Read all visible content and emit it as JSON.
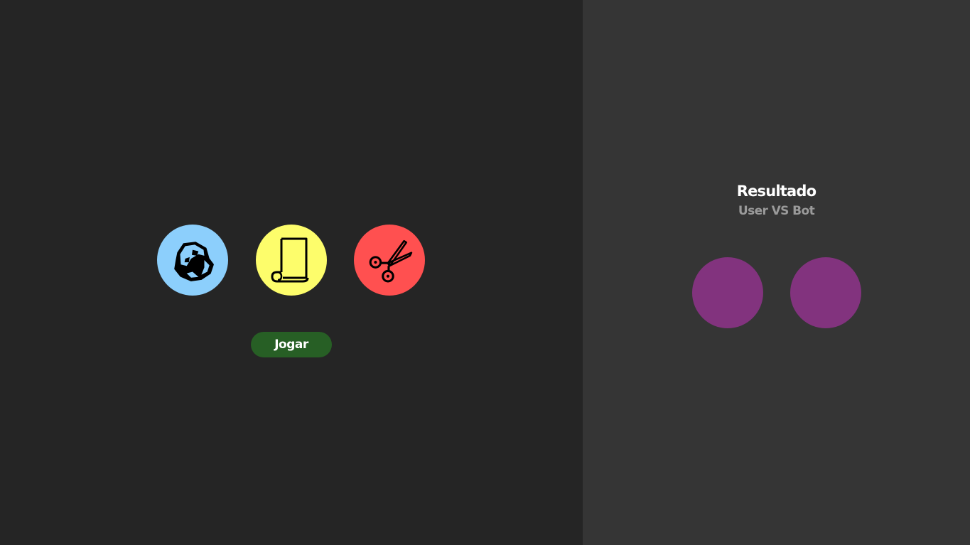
{
  "game": {
    "choices": [
      {
        "name": "rock",
        "color": "#8ccffc",
        "icon": "rock-icon"
      },
      {
        "name": "paper",
        "color": "#fdfd6b",
        "icon": "paper-scroll-icon"
      },
      {
        "name": "scissors",
        "color": "#ff5050",
        "icon": "scissors-icon"
      }
    ],
    "play_label": "Jogar",
    "play_color": "#275f25"
  },
  "result": {
    "title": "Resultado",
    "subtitle": "User VS Bot",
    "slot_color": "#82337e"
  },
  "colors": {
    "left_background": "#252525",
    "right_background": "#353535"
  }
}
